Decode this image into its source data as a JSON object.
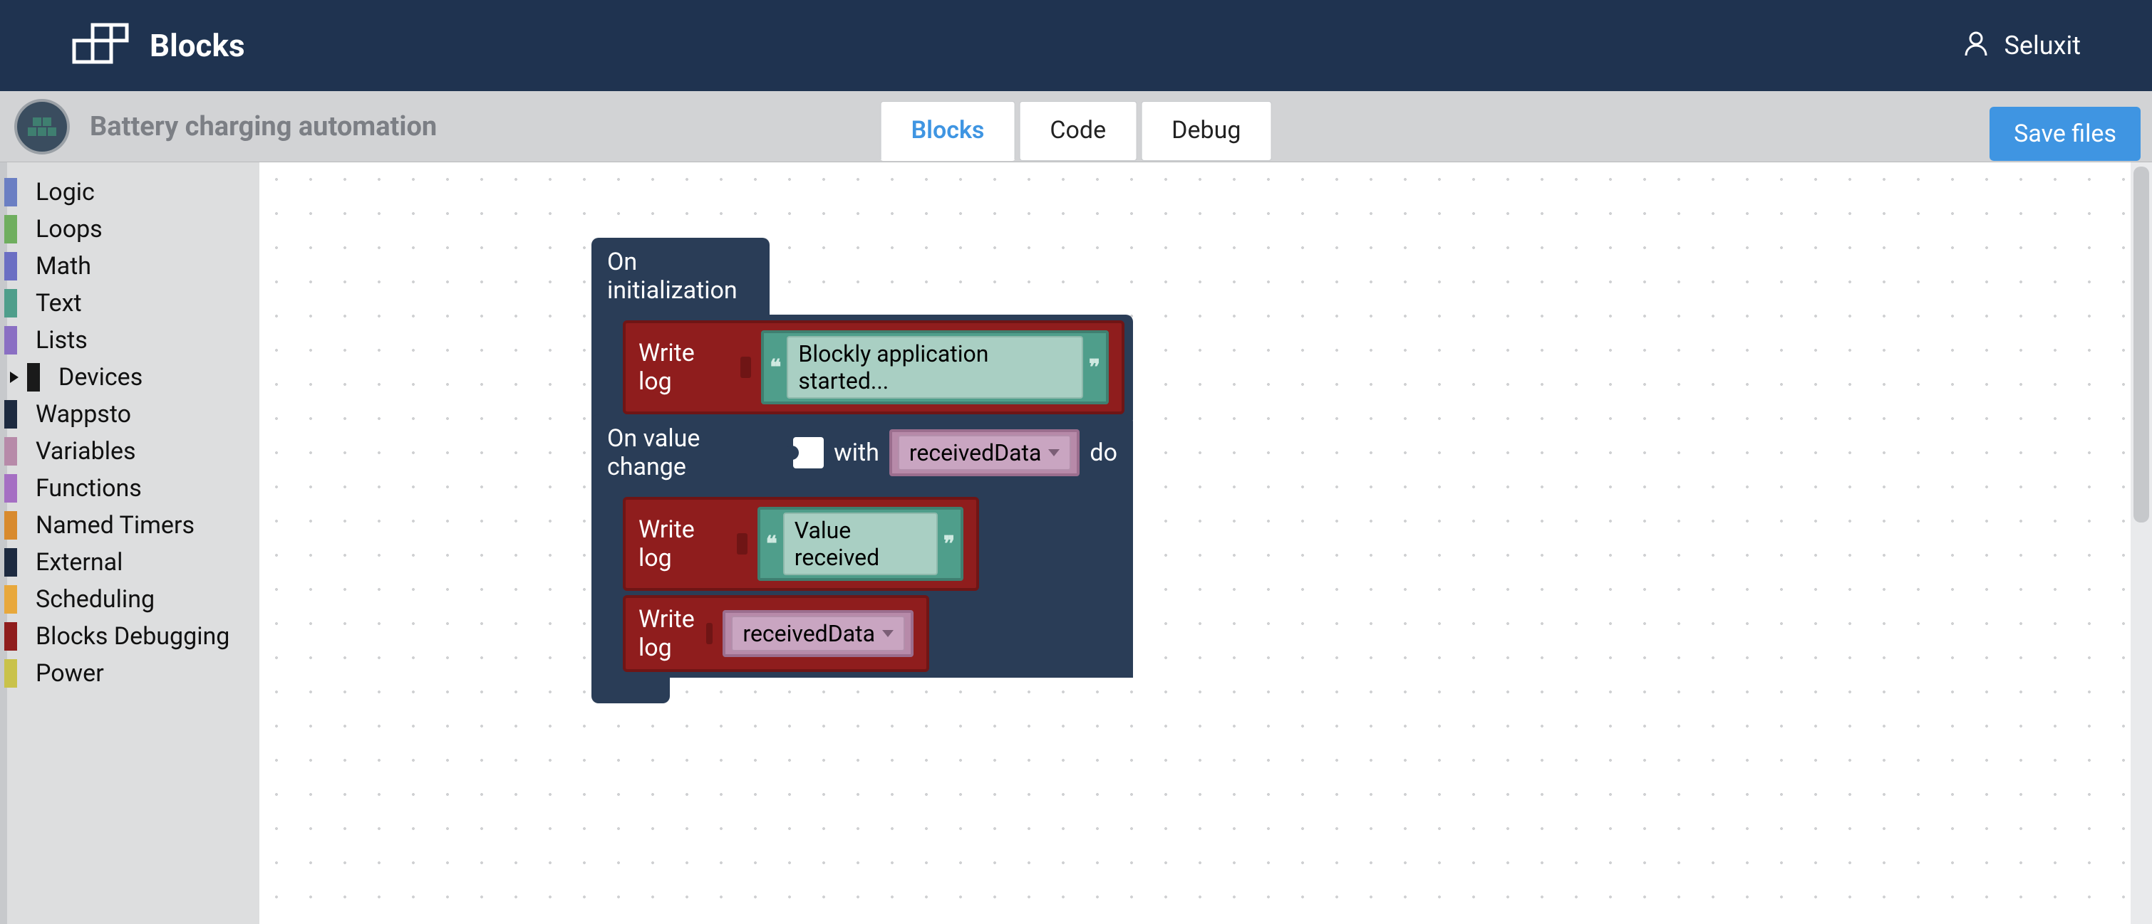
{
  "header": {
    "app_title": "Blocks",
    "username": "Seluxit"
  },
  "project": {
    "title": "Battery charging automation"
  },
  "tabs": [
    {
      "label": "Blocks",
      "active": true
    },
    {
      "label": "Code",
      "active": false
    },
    {
      "label": "Debug",
      "active": false
    }
  ],
  "save_button": "Save files",
  "toolbox": [
    {
      "label": "Logic",
      "color": "#6b7fc3"
    },
    {
      "label": "Loops",
      "color": "#6fae5f"
    },
    {
      "label": "Math",
      "color": "#6b6fc3"
    },
    {
      "label": "Text",
      "color": "#4f9e8b"
    },
    {
      "label": "Lists",
      "color": "#8a6fc3"
    },
    {
      "label": "Devices",
      "color": "#1a1a1a",
      "expandable": true
    },
    {
      "label": "Wappsto",
      "color": "#1d2a40"
    },
    {
      "label": "Variables",
      "color": "#b78aa9"
    },
    {
      "label": "Functions",
      "color": "#a56fc3"
    },
    {
      "label": "Named Timers",
      "color": "#d88a2e"
    },
    {
      "label": "External",
      "color": "#1d2a40"
    },
    {
      "label": "Scheduling",
      "color": "#e8a83c"
    },
    {
      "label": "Blocks Debugging",
      "color": "#8f1d1d"
    },
    {
      "label": "Power",
      "color": "#c9c24a"
    }
  ],
  "canvas": {
    "block1": {
      "hat_label": "On initialization",
      "writelog_label": "Write log",
      "string_value": "Blockly application started..."
    },
    "block2": {
      "hat_prefix": "On value change",
      "hat_mid": "with",
      "hat_var": "receivedData",
      "hat_suffix": "do",
      "writelog_label": "Write log",
      "string_value": "Value received",
      "writelog2_label": "Write log",
      "var_value": "receivedData"
    }
  }
}
